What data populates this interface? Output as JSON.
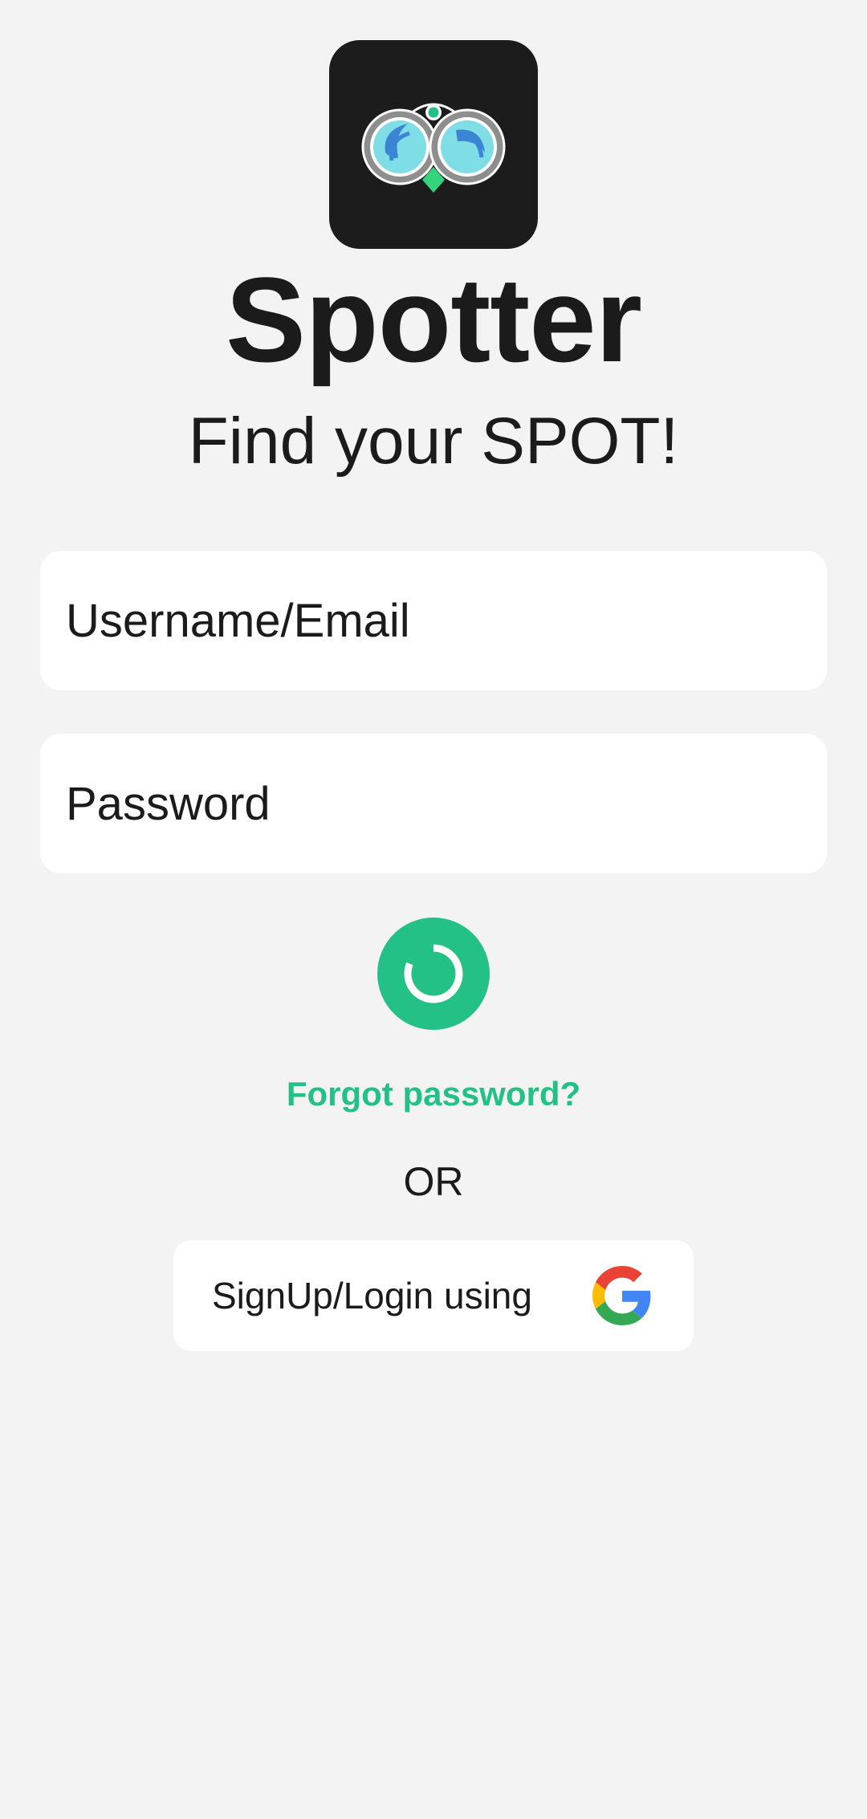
{
  "app": {
    "title": "Spotter",
    "tagline": "Find your SPOT!"
  },
  "login_form": {
    "username_placeholder": "Username/Email",
    "password_placeholder": "Password"
  },
  "links": {
    "forgot_password": "Forgot password?"
  },
  "separator": {
    "or_text": "OR"
  },
  "google_login": {
    "label": "SignUp/Login using"
  },
  "icons": {
    "app_logo": "binoculars-logo-icon",
    "submit": "loading-spinner-icon",
    "google": "google-icon"
  },
  "colors": {
    "background": "#f2f3f2",
    "accent": "#24c187",
    "logo_background": "#1c1c1c",
    "text": "#1b1b1b",
    "field_background": "#ffffff"
  }
}
